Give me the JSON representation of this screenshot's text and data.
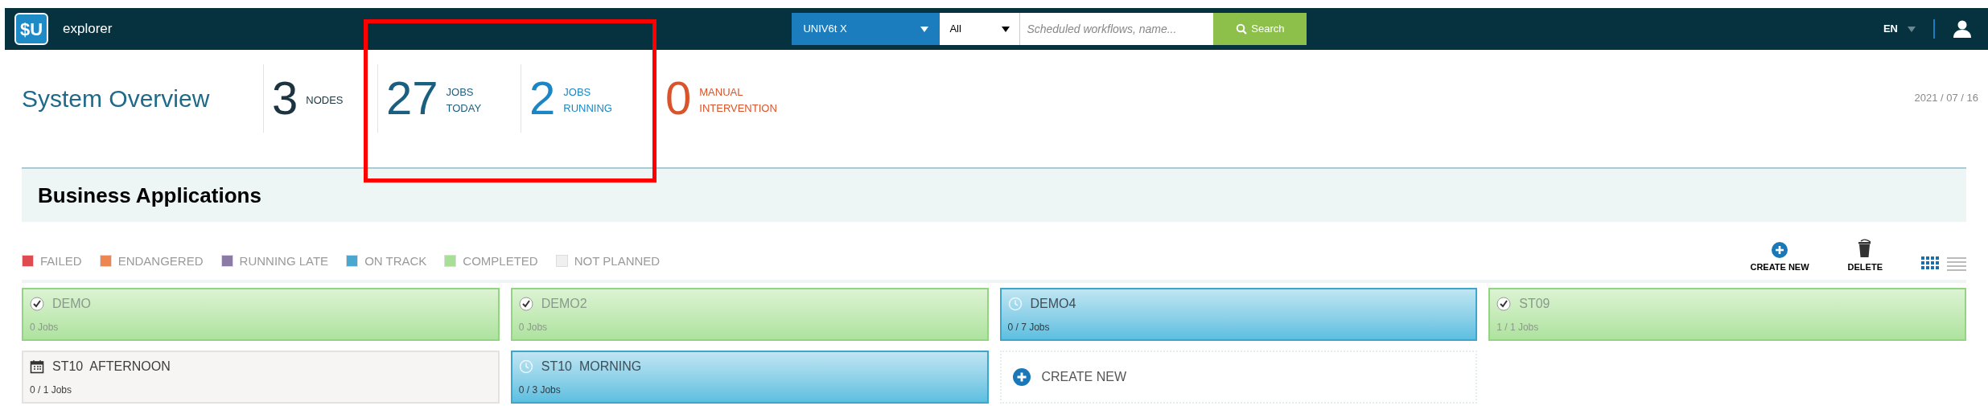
{
  "topbar": {
    "logo": "$U",
    "app_name": "explorer",
    "environment": {
      "label": "UNIV6t X"
    },
    "filter": {
      "value": "All"
    },
    "search": {
      "placeholder": "Scheduled workflows, name...",
      "button": "Search"
    },
    "language": "EN"
  },
  "overview": {
    "title": "System Overview",
    "stats": [
      {
        "value": "3",
        "label": [
          "NODES"
        ],
        "color": "#1c3441"
      },
      {
        "value": "27",
        "label": [
          "JOBS",
          "TODAY"
        ],
        "color": "#1b5f80"
      },
      {
        "value": "2",
        "label": [
          "JOBS",
          "RUNNING"
        ],
        "color": "#1a87c4"
      },
      {
        "value": "0",
        "label": [
          "MANUAL",
          "INTERVENTION"
        ],
        "color": "#d9542a"
      }
    ],
    "date": "2021 / 07 / 16"
  },
  "section": {
    "title": "Business Applications"
  },
  "legend": [
    {
      "label": "FAILED",
      "color": "#de4b50"
    },
    {
      "label": "ENDANGERED",
      "color": "#ee8650"
    },
    {
      "label": "RUNNING LATE",
      "color": "#8a7aa6"
    },
    {
      "label": "ON TRACK",
      "color": "#4aa8d0"
    },
    {
      "label": "COMPLETED",
      "color": "#a6df95"
    },
    {
      "label": "NOT PLANNED",
      "color": "#f0f0f0"
    }
  ],
  "toolbar": {
    "buttons": [
      {
        "label": "CREATE NEW",
        "kind": "create"
      },
      {
        "label": "DELETE",
        "kind": "delete"
      }
    ],
    "views": [
      {
        "kind": "grid",
        "selected": true
      },
      {
        "kind": "list",
        "selected": false
      }
    ]
  },
  "apps": [
    {
      "name": "DEMO",
      "jobs": "0 Jobs",
      "kind": "completed"
    },
    {
      "name": "DEMO2",
      "jobs": "0 Jobs",
      "kind": "completed"
    },
    {
      "name": "DEMO4",
      "jobs": "0 / 7 Jobs",
      "kind": "ontrack"
    },
    {
      "name": "ST09",
      "jobs": "1 / 1 Jobs",
      "kind": "completed"
    },
    {
      "name": "ST10  AFTERNOON",
      "jobs": "0 / 1 Jobs",
      "kind": "unplanned"
    },
    {
      "name": "ST10  MORNING",
      "jobs": "0 / 3 Jobs",
      "kind": "ontrack"
    }
  ],
  "create_tile": {
    "label": "CREATE NEW"
  }
}
